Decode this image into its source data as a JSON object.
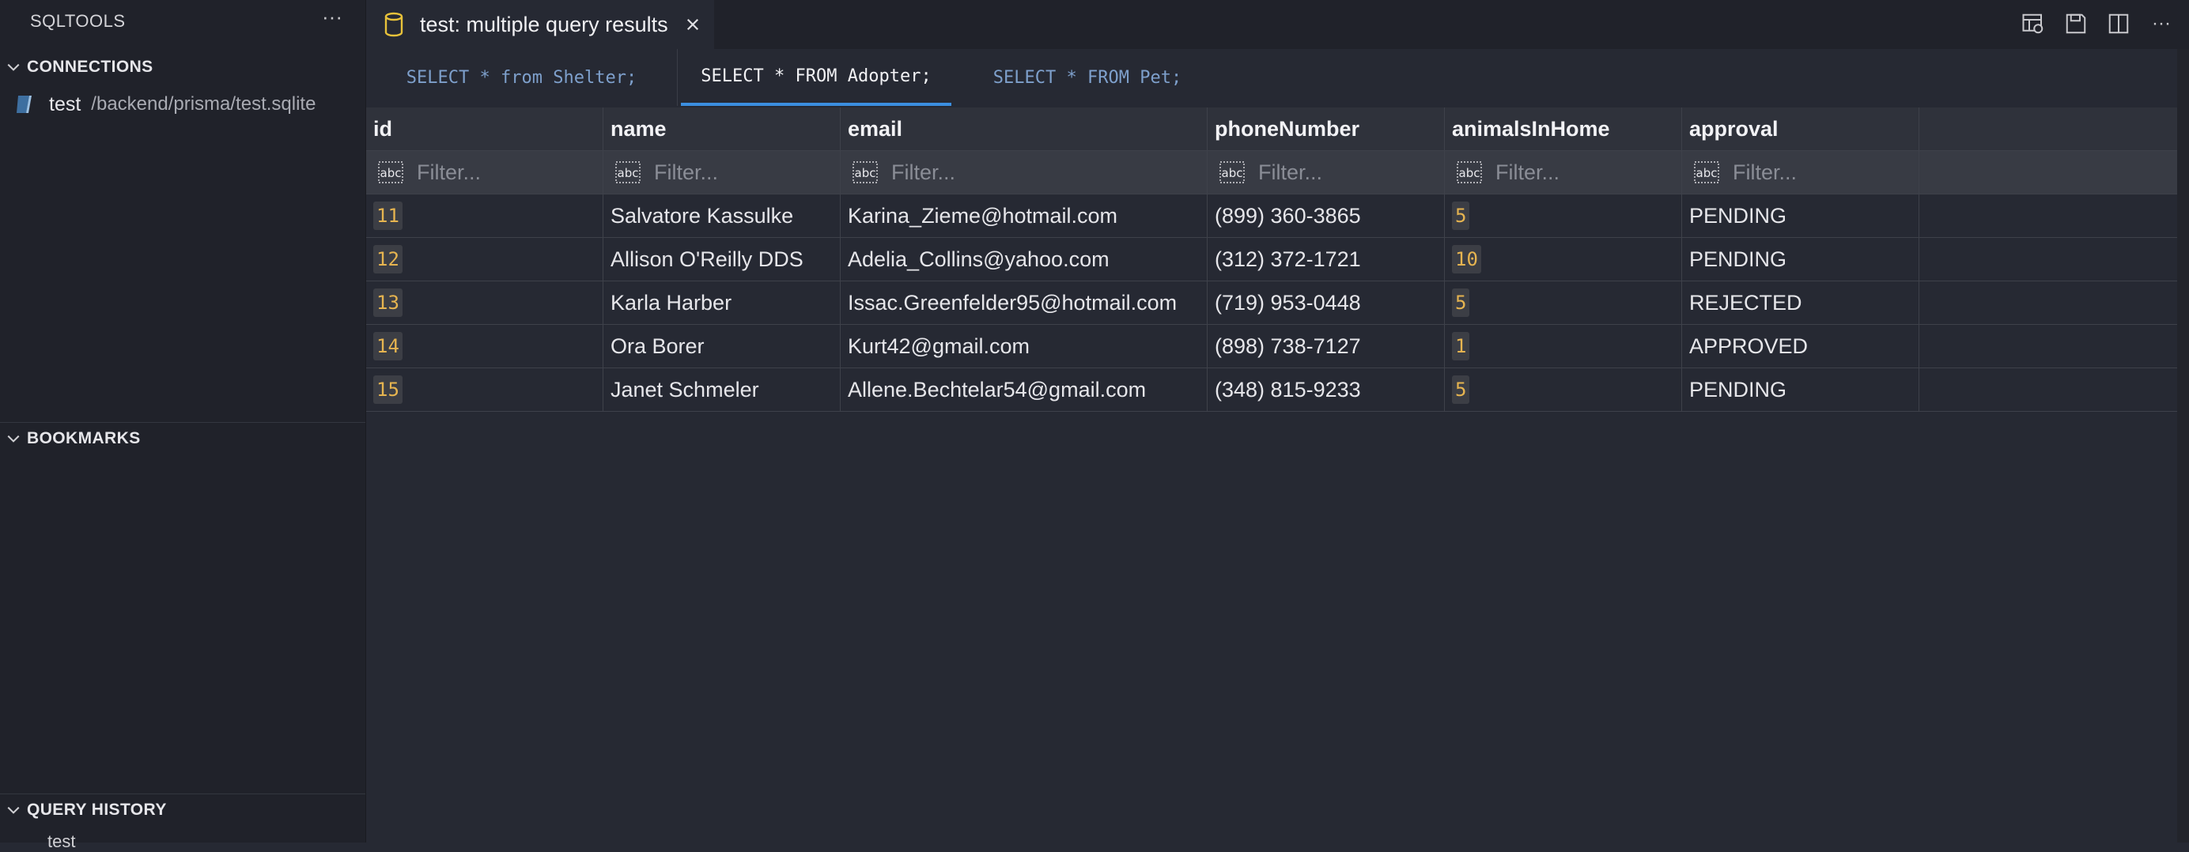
{
  "sidebar": {
    "title": "SQLTOOLS",
    "more_label": "···",
    "sections": {
      "connections": "CONNECTIONS",
      "bookmarks": "BOOKMARKS",
      "query_history": "QUERY HISTORY"
    },
    "connection": {
      "name": "test",
      "path": "/backend/prisma/test.sqlite",
      "icon": "sqlite-db-icon"
    },
    "history_peek": "test"
  },
  "editor": {
    "tab_label": "test: multiple query results",
    "tab_icon": "database-icon",
    "actions": [
      "open-table-icon",
      "save-icon",
      "split-editor-icon",
      "more-actions-icon"
    ],
    "more_label": "···"
  },
  "query_tabs": [
    {
      "label": "SELECT * from Shelter;",
      "active": false
    },
    {
      "label": "SELECT * FROM Adopter;",
      "active": true
    },
    {
      "label": "SELECT * FROM Pet;",
      "active": false
    }
  ],
  "table": {
    "columns": [
      "id",
      "name",
      "email",
      "phoneNumber",
      "animalsInHome",
      "approval"
    ],
    "filter_placeholder": "Filter...",
    "rows": [
      {
        "id": "11",
        "name": "Salvatore Kassulke",
        "email": "Karina_Zieme@hotmail.com",
        "phone": "(899) 360-3865",
        "animals": "5",
        "approval": "PENDING"
      },
      {
        "id": "12",
        "name": "Allison O'Reilly DDS",
        "email": "Adelia_Collins@yahoo.com",
        "phone": "(312) 372-1721",
        "animals": "10",
        "approval": "PENDING"
      },
      {
        "id": "13",
        "name": "Karla Harber",
        "email": "Issac.Greenfelder95@hotmail.com",
        "phone": "(719) 953-0448",
        "animals": "5",
        "approval": "REJECTED"
      },
      {
        "id": "14",
        "name": "Ora Borer",
        "email": "Kurt42@gmail.com",
        "phone": "(898) 738-7127",
        "animals": "1",
        "approval": "APPROVED"
      },
      {
        "id": "15",
        "name": "Janet Schmeler",
        "email": "Allene.Bechtelar54@gmail.com",
        "phone": "(348) 815-9233",
        "animals": "5",
        "approval": "PENDING"
      }
    ]
  },
  "colors": {
    "background": "#262933",
    "sidebar": "#20222a",
    "accent": "#3b8ee0",
    "number": "#e6b450",
    "db_icon": "#e8c23a"
  }
}
